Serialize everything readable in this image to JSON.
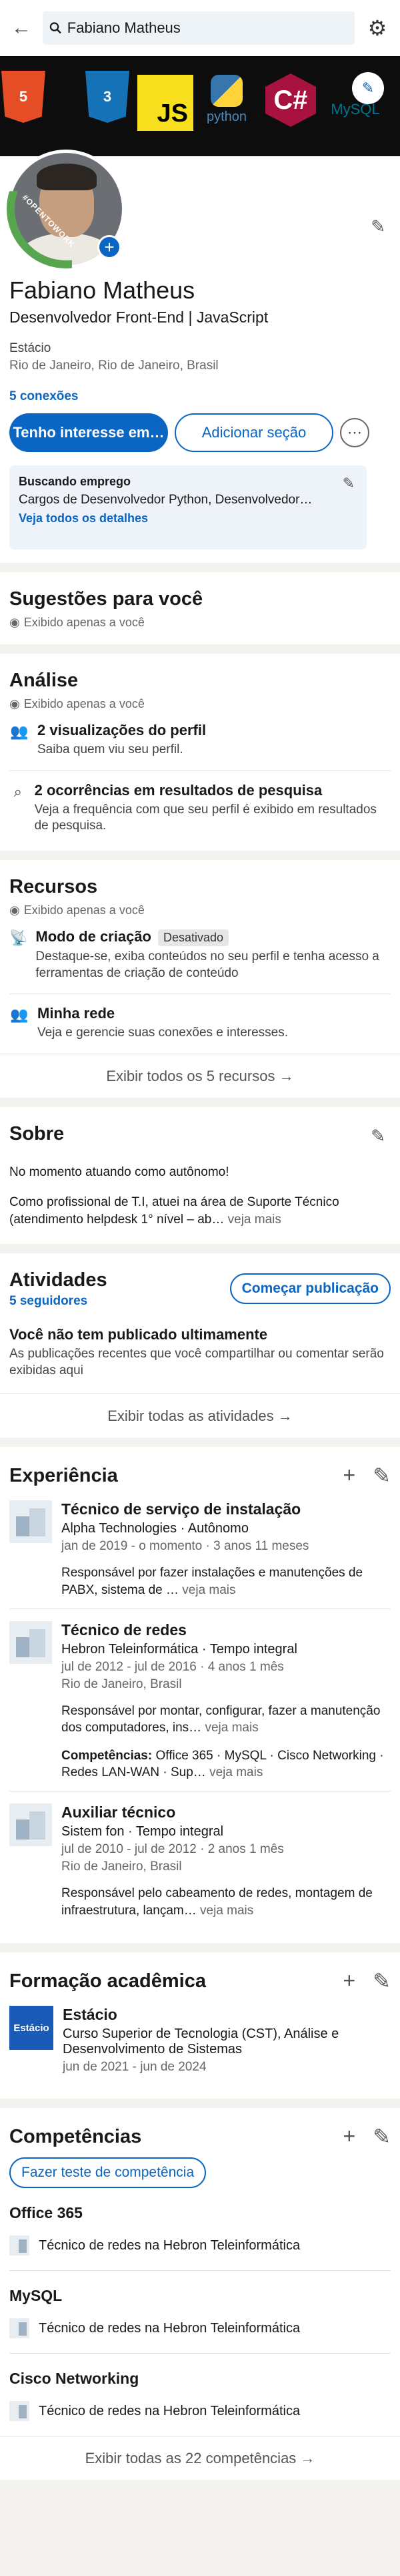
{
  "search": {
    "value": "Fabiano Matheus"
  },
  "banner": {
    "logos": [
      "5",
      "3",
      "JS",
      "python",
      "C#",
      "MySQL"
    ]
  },
  "profile": {
    "otw_label": "#OPENTOWORK",
    "name": "Fabiano Matheus",
    "headline": "Desenvolvedor Front-End  |  JavaScript",
    "school": "Estácio",
    "location": "Rio de Janeiro, Rio de Janeiro, Brasil",
    "connections": "5 conexões",
    "btn_interest": "Tenho interesse em…",
    "btn_add_section": "Adicionar seção",
    "btn_more": "⋯",
    "otw_title": "Buscando emprego",
    "otw_desc": "Cargos de Desenvolvedor Python, Desenvolvedor…",
    "otw_link": "Veja todos os detalhes"
  },
  "suggestions": {
    "title": "Sugestões para você",
    "private": "Exibido apenas a você"
  },
  "analytics": {
    "title": "Análise",
    "private": "Exibido apenas a você",
    "items": [
      {
        "title": "2 visualizações do perfil",
        "sub": "Saiba quem viu seu perfil."
      },
      {
        "title": "2 ocorrências em resultados de pesquisa",
        "sub": "Veja a frequência com que seu perfil é exibido em resultados de pesquisa."
      }
    ]
  },
  "resources": {
    "title": "Recursos",
    "private": "Exibido apenas a você",
    "items": [
      {
        "title": "Modo de criação",
        "badge": "Desativado",
        "sub": "Destaque-se, exiba conteúdos no seu perfil e tenha acesso a ferramentas de criação de conteúdo"
      },
      {
        "title": "Minha rede",
        "sub": "Veja e gerencie suas conexões e interesses."
      }
    ],
    "show_all": "Exibir todos os 5 recursos →"
  },
  "about": {
    "title": "Sobre",
    "p1": "No momento atuando como autônomo!",
    "p2": "Como profissional de T.I, atuei na área de Suporte Técnico (atendimento helpdesk 1° nível – ab…",
    "more": "veja mais"
  },
  "activity": {
    "title": "Atividades",
    "followers": "5 seguidores",
    "btn": "Começar publicação",
    "empty_title": "Você não tem publicado ultimamente",
    "empty_sub": "As publicações recentes que você compartilhar ou comentar serão exibidas aqui",
    "show_all": "Exibir todas as atividades →"
  },
  "experience": {
    "title": "Experiência",
    "items": [
      {
        "title": "Técnico de serviço de instalação",
        "company": "Alpha Technologies · Autônomo",
        "dates": "jan de 2019 - o momento · 3 anos 11 meses",
        "desc": "Responsável por fazer instalações e manutenções de PABX, sistema de …",
        "more": "veja mais"
      },
      {
        "title": "Técnico de redes",
        "company": "Hebron Teleinformática · Tempo integral",
        "dates": "jul de 2012 - jul de 2016 · 4 anos 1 mês",
        "location": "Rio de Janeiro, Brasil",
        "desc": "Responsável  por montar, configurar, fazer a manutenção dos computadores, ins…",
        "more": "veja mais",
        "skills_label": "Competências:",
        "skills": "Office 365 · MySQL · Cisco Networking · Redes LAN-WAN · Sup…",
        "skills_more": "veja mais"
      },
      {
        "title": "Auxiliar técnico",
        "company": "Sistem fon  · Tempo integral",
        "dates": "jul de 2010 - jul de 2012 · 2 anos 1 mês",
        "location": "Rio de Janeiro, Brasil",
        "desc": "Responsável pelo  cabeamento de redes, montagem de infraestrutura, lançam…",
        "more": "veja mais"
      }
    ]
  },
  "education": {
    "title": "Formação acadêmica",
    "logo_text": "Estácio",
    "school": "Estácio",
    "degree": "Curso Superior de Tecnologia (CST), Análise e Desenvolvimento de Sistemas",
    "dates": "jun de 2021 - jun de 2024"
  },
  "skills": {
    "title": "Competências",
    "btn": "Fazer teste de competência",
    "items": [
      {
        "name": "Office 365",
        "source": "Técnico de redes na Hebron Teleinformática"
      },
      {
        "name": "MySQL",
        "source": "Técnico de redes na Hebron Teleinformática"
      },
      {
        "name": "Cisco Networking",
        "source": "Técnico de redes na Hebron Teleinformática"
      }
    ],
    "show_all": "Exibir todas as 22 competências →"
  }
}
